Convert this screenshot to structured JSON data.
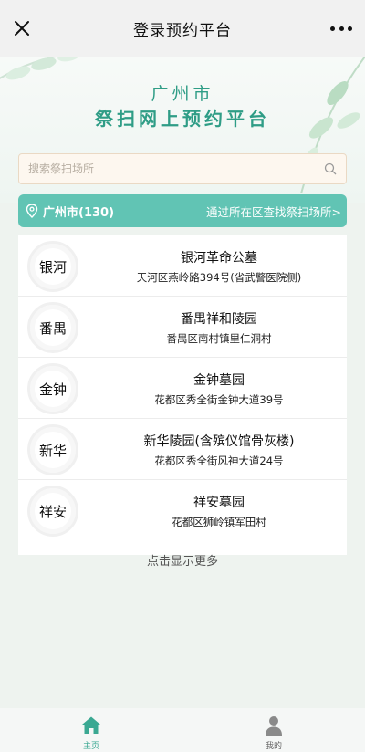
{
  "topbar": {
    "title": "登录预约平台"
  },
  "hero": {
    "city": "广州市",
    "title": "祭扫网上预约平台"
  },
  "search": {
    "placeholder": "搜索祭扫场所"
  },
  "region": {
    "label": "广州市(130)",
    "link": "通过所在区查找祭扫场所>"
  },
  "places": [
    {
      "badge": "银河",
      "name": "银河革命公墓",
      "address": "天河区燕岭路394号(省武警医院侧)"
    },
    {
      "badge": "番禺",
      "name": "番禺祥和陵园",
      "address": "番禺区南村镇里仁洞村"
    },
    {
      "badge": "金钟",
      "name": "金钟墓园",
      "address": "花都区秀全街金钟大道39号"
    },
    {
      "badge": "新华",
      "name": "新华陵园(含殡仪馆骨灰楼)",
      "address": "花都区秀全街风神大道24号"
    },
    {
      "badge": "祥安",
      "name": "祥安墓园",
      "address": "花都区狮岭镇军田村"
    }
  ],
  "more": "点击显示更多",
  "tabs": [
    {
      "label": "主页",
      "icon": "home-icon",
      "active": true
    },
    {
      "label": "我的",
      "icon": "user-icon",
      "active": false
    }
  ],
  "colors": {
    "accent": "#61c4b4",
    "title": "#2f9d86"
  }
}
